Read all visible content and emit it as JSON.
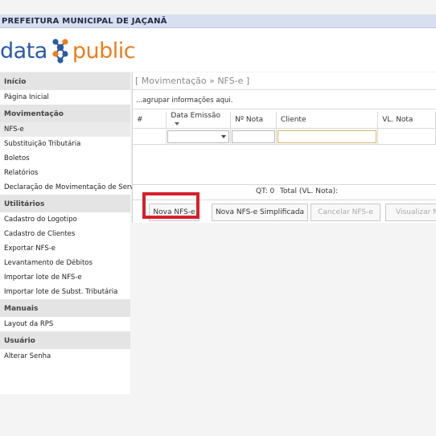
{
  "topbar": {
    "title": "PREFEITURA MUNICIPAL DE JAÇANÃ"
  },
  "logo": {
    "word1": "data",
    "word2": "public"
  },
  "sidebar": {
    "sections": [
      {
        "title": "Início",
        "items": [
          "Página Inicial"
        ]
      },
      {
        "title": "Movimentação",
        "items": [
          "NFS-e",
          "Substituição Tributária",
          "Boletos",
          "Relatórios",
          "Declaração de Movimentação de Serviço"
        ]
      },
      {
        "title": "Utilitários",
        "items": [
          "Cadastro do Logotipo",
          "Cadastro de Clientes",
          "Exportar NFS-e",
          "Levantamento de Débitos",
          "Importar lote de NFS-e",
          "Importar lote de Subst. Tributária"
        ]
      },
      {
        "title": "Manuais",
        "items": [
          "Layout da RPS"
        ]
      },
      {
        "title": "Usuário",
        "items": [
          "Alterar Senha"
        ]
      }
    ]
  },
  "main": {
    "breadcrumb": "[ Movimentação » NFS-e ]",
    "group_hint": "...agrupar informações aqui.",
    "columns": [
      "#",
      "Data Emissão",
      "Nº Nota",
      "Cliente",
      "VL. Nota"
    ],
    "qt": "QT: 0",
    "total": "Total (VL. Nota):",
    "buttons": [
      "Nova NFS-e",
      "Nova NFS-e Simplificada",
      "Cancelar NFS-e",
      "Visualizar NFS-e"
    ]
  }
}
